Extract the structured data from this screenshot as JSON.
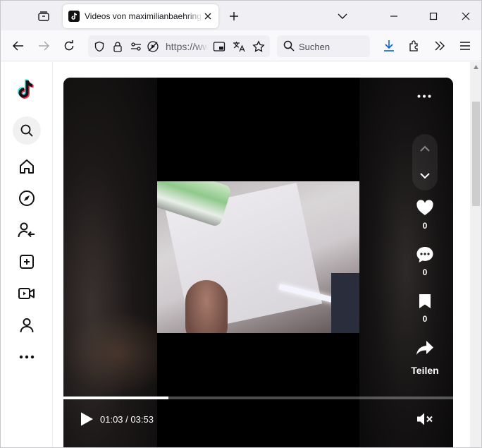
{
  "browser": {
    "tab": {
      "title": "Videos von maximilianbaehring"
    },
    "url": "https://www",
    "search_placeholder": "Suchen"
  },
  "video": {
    "current_time": "01:03",
    "separator": "/",
    "duration": "03:53",
    "progress_fraction": 0.27,
    "likes": "0",
    "comments": "0",
    "saves": "0",
    "share_label": "Teilen"
  },
  "colors": {
    "accent_download": "#0061e0",
    "tiktok_cyan": "#25f4ee",
    "tiktok_red": "#fe2c55"
  }
}
